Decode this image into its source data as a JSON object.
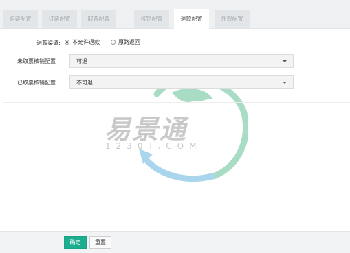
{
  "tabs": [
    {
      "label": "购票配置",
      "active": false
    },
    {
      "label": "订票配置",
      "active": false
    },
    {
      "label": "取票配置",
      "active": false
    },
    {
      "label": "核销配置",
      "active": false
    },
    {
      "label": "退款配置",
      "active": true
    },
    {
      "label": "外观配置",
      "active": false
    }
  ],
  "form": {
    "refund_channel": {
      "label": "退款渠道:",
      "options": [
        {
          "label": "不允许退款",
          "selected": true
        },
        {
          "label": "原路返回",
          "selected": false
        }
      ]
    },
    "unclaimed_ticket": {
      "label": "未取票核销配置",
      "value": "可退"
    },
    "claimed_ticket": {
      "label": "已取票核销配置",
      "value": "不可退"
    }
  },
  "watermark": {
    "brand": "易景通",
    "domain": "1230T.COM"
  },
  "footer": {
    "confirm_label": "确定",
    "reset_label": "重置"
  },
  "colors": {
    "accent": "#1cae8f",
    "watermark_green": "#a8dcc4",
    "watermark_blue": "#a9d6ec"
  }
}
